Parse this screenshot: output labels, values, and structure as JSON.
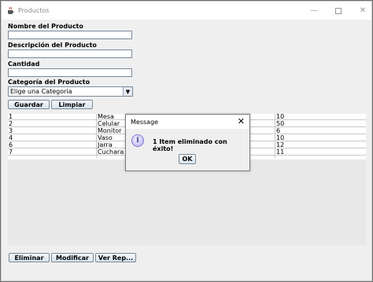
{
  "window": {
    "title": "Productos"
  },
  "form": {
    "name_label": "Nombre del Producto",
    "name_value": "",
    "description_label": "Descripción del Producto",
    "description_value": "",
    "quantity_label": "Cantidad",
    "quantity_value": "",
    "category_label": "Categoría del Producto",
    "category_selected": "Elige una Categoria"
  },
  "buttons": {
    "save": "Guardar",
    "clear": "Limpiar",
    "delete": "Eliminar",
    "modify": "Modificar",
    "view_report": "Ver Rep..."
  },
  "table": {
    "rows": [
      {
        "id": "1",
        "name": "Mesa",
        "qty": "10"
      },
      {
        "id": "2",
        "name": "Celular",
        "qty": "50"
      },
      {
        "id": "3",
        "name": "Monitor",
        "qty": "6"
      },
      {
        "id": "4",
        "name": "Vaso",
        "qty": "10"
      },
      {
        "id": "6",
        "name": "Jarra",
        "qty": "12"
      },
      {
        "id": "7",
        "name": "Cuchara",
        "qty": "11"
      }
    ]
  },
  "dialog": {
    "title": "Message",
    "message": "1 Item eliminado con éxito!",
    "ok_label": "OK",
    "close_glyph": "✕",
    "icon_glyph": "i"
  },
  "icons": {
    "app": "java-cup-icon",
    "minimize": "minimize-icon",
    "maximize": "maximize-icon",
    "close": "close-icon",
    "dropdown": "chevron-down-icon",
    "info": "info-icon"
  },
  "colors": {
    "window_bg": "#efefef",
    "button_border": "#7a8a99",
    "info_icon": "#b6b0ec"
  }
}
